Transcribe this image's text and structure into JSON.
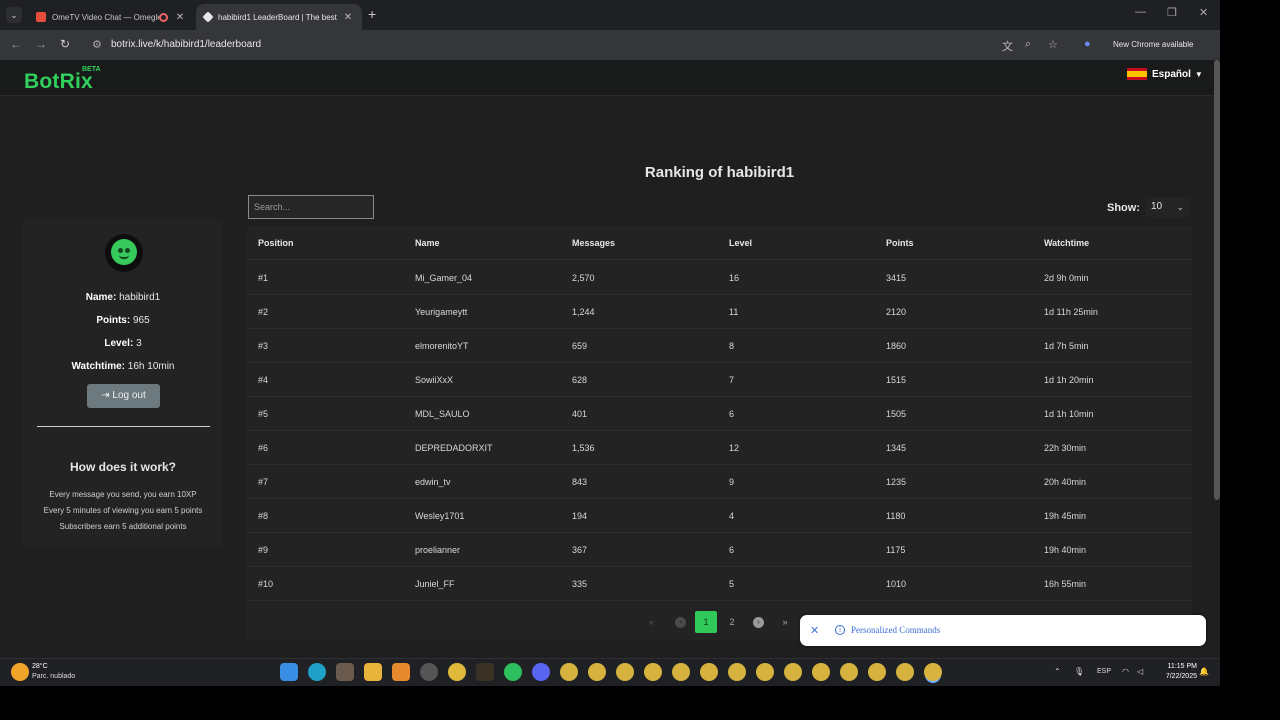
{
  "tabs": [
    {
      "title": "OmeTV Video Chat — Omegle",
      "active": false
    },
    {
      "title": "habibird1 LeaderBoard | The best",
      "active": true
    }
  ],
  "address": {
    "url": "botrix.live/k/habibird1/leaderboard",
    "update_label": "New Chrome available"
  },
  "site": {
    "logo": "BotRix",
    "beta": "BETA",
    "language": "Español"
  },
  "heading": "Ranking of habibird1",
  "search": {
    "placeholder": "Search..."
  },
  "show": {
    "label": "Show:",
    "value": "10"
  },
  "profile": {
    "name_label": "Name:",
    "name": "habibird1",
    "points_label": "Points:",
    "points": "965",
    "level_label": "Level:",
    "level": "3",
    "watchtime_label": "Watchtime:",
    "watchtime": "16h 10min",
    "logout_label": "Log out"
  },
  "how": {
    "title": "How does it work?",
    "rules": [
      "Every message you send, you earn 10XP",
      "Every 5 minutes of viewing you earn 5 points",
      "Subscribers earn 5 additional points"
    ]
  },
  "table": {
    "columns": [
      "Position",
      "Name",
      "Messages",
      "Level",
      "Points",
      "Watchtime"
    ],
    "rows": [
      [
        "#1",
        "Mi_Gamer_04",
        "2,570",
        "16",
        "3415",
        "2d 9h 0min"
      ],
      [
        "#2",
        "Yeurigameytt",
        "1,244",
        "11",
        "2120",
        "1d 11h 25min"
      ],
      [
        "#3",
        "elmorenitoYT",
        "659",
        "8",
        "1860",
        "1d 7h 5min"
      ],
      [
        "#4",
        "SowiiXxX",
        "628",
        "7",
        "1515",
        "1d 1h 20min"
      ],
      [
        "#5",
        "MDL_SAULO",
        "401",
        "6",
        "1505",
        "1d 1h 10min"
      ],
      [
        "#6",
        "DEPREDADORXIT",
        "1,536",
        "12",
        "1345",
        "22h 30min"
      ],
      [
        "#7",
        "edwin_tv",
        "843",
        "9",
        "1235",
        "20h 40min"
      ],
      [
        "#8",
        "Wesley1701",
        "194",
        "4",
        "1180",
        "19h 45min"
      ],
      [
        "#9",
        "proelianner",
        "367",
        "6",
        "1175",
        "19h 40min"
      ],
      [
        "#10",
        "Juniel_FF",
        "335",
        "5",
        "1010",
        "16h 55min"
      ]
    ]
  },
  "pagination": {
    "first": "«",
    "prev": "‹",
    "pages": [
      "1",
      "2"
    ],
    "current": "1",
    "next": "›",
    "last": "»"
  },
  "toast": {
    "text": "Personalized Commands"
  },
  "taskbar": {
    "temperature": "28°C",
    "weather": "Parc. nublado",
    "lang": "ESP",
    "time": "11:15 PM",
    "date": "7/22/2025"
  },
  "colors": {
    "brand_green": "#31d05c",
    "page_bg": "#1f1f1f",
    "panel_bg": "#232323",
    "toast_text": "#3b6fd4"
  }
}
